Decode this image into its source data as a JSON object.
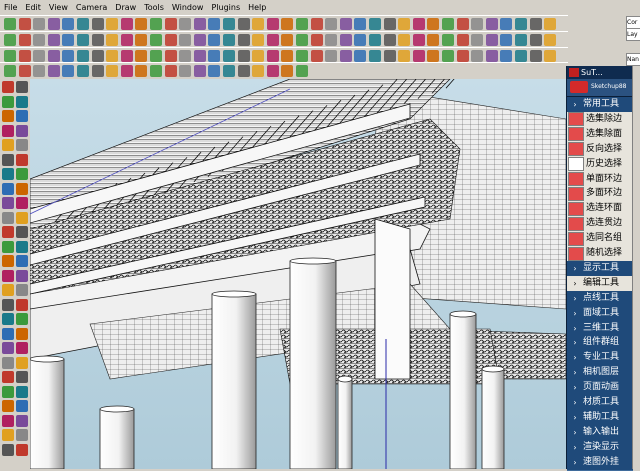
{
  "menu": [
    "File",
    "Edit",
    "View",
    "Camera",
    "Draw",
    "Tools",
    "Window",
    "Plugins",
    "Help"
  ],
  "right_tabs": [
    "Cor",
    "Lay",
    "Nan"
  ],
  "plugin": {
    "title": "SuT...",
    "logo_text": "Sketchup88",
    "items": [
      {
        "label": "常用工具",
        "style": "blue",
        "icon": "arrow"
      },
      {
        "label": "选集除边",
        "style": "gray",
        "icon": "select-cube-icon"
      },
      {
        "label": "选集除面",
        "style": "gray",
        "icon": "face-cube-icon"
      },
      {
        "label": "反向选择",
        "style": "gray",
        "icon": "invert-cube-icon"
      },
      {
        "label": "历史选择",
        "style": "gray",
        "icon": "blank"
      },
      {
        "label": "单面环边",
        "style": "gray",
        "icon": "loop-icon"
      },
      {
        "label": "多面环边",
        "style": "gray",
        "icon": "multi-loop-icon"
      },
      {
        "label": "选连环面",
        "style": "gray",
        "icon": "ring-icon"
      },
      {
        "label": "选连贯边",
        "style": "gray",
        "icon": "chain-icon"
      },
      {
        "label": "选同名组",
        "style": "gray",
        "icon": "group-icon"
      },
      {
        "label": "随机选择",
        "style": "gray",
        "icon": "random-icon"
      },
      {
        "label": "显示工具",
        "style": "blue",
        "icon": "arrow"
      },
      {
        "label": "编辑工具",
        "style": "gray",
        "icon": "arrow"
      },
      {
        "label": "点线工具",
        "style": "blue",
        "icon": "arrow"
      },
      {
        "label": "面域工具",
        "style": "blue",
        "icon": "arrow"
      },
      {
        "label": "三维工具",
        "style": "blue",
        "icon": "arrow"
      },
      {
        "label": "组件群组",
        "style": "blue",
        "icon": "arrow"
      },
      {
        "label": "专业工具",
        "style": "blue",
        "icon": "arrow"
      },
      {
        "label": "相机图层",
        "style": "blue",
        "icon": "arrow"
      },
      {
        "label": "页面动画",
        "style": "blue",
        "icon": "arrow"
      },
      {
        "label": "材质工具",
        "style": "blue",
        "icon": "arrow"
      },
      {
        "label": "辅助工具",
        "style": "blue",
        "icon": "arrow"
      },
      {
        "label": "输入输出",
        "style": "blue",
        "icon": "arrow"
      },
      {
        "label": "渲染显示",
        "style": "blue",
        "icon": "arrow"
      },
      {
        "label": "速图外挂",
        "style": "blue",
        "icon": "arrow"
      }
    ]
  },
  "colors": {
    "sky": "#b9d5e3",
    "panel_blue": "#1f4a7a",
    "roof_line": "#1a1a1a",
    "accent_blue_axis": "#2a2aa8"
  }
}
